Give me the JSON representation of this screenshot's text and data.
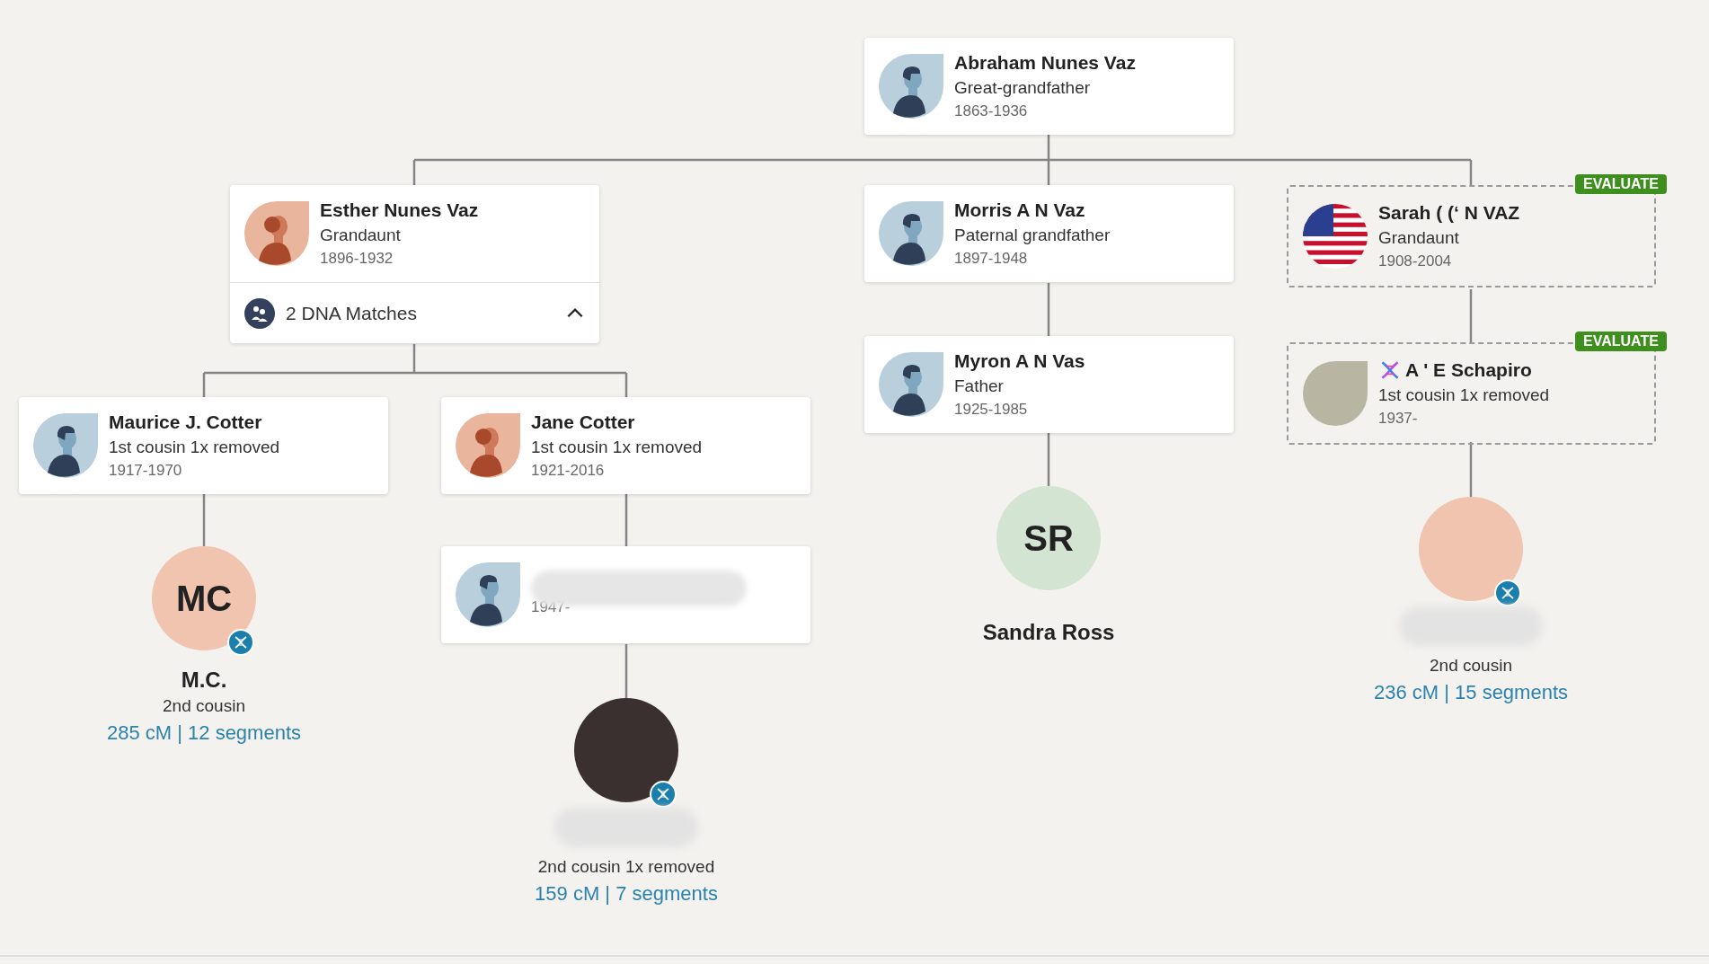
{
  "cards": [
    {
      "name": "Abraham Nunes Vaz",
      "relation": "Great-grandfather",
      "years": "1863-1936",
      "kind": "male",
      "dashed": false
    },
    {
      "name": "Esther Nunes Vaz",
      "relation": "Grandaunt",
      "years": "1896-1932",
      "kind": "female",
      "dashed": false,
      "dna_matches": {
        "label": "2 DNA Matches",
        "expanded": true
      }
    },
    {
      "name": "Morris A N Vaz",
      "relation": "Paternal grandfather",
      "years": "1897-1948",
      "kind": "male",
      "dashed": false
    },
    {
      "name": "Sarah ( (‘ N VAZ",
      "relation": "Grandaunt",
      "years": "1908-2004",
      "kind": "flag",
      "dashed": true,
      "badge": "EVALUATE"
    },
    {
      "name": "Myron A N Vas",
      "relation": "Father",
      "years": "1925-1985",
      "kind": "male",
      "dashed": false
    },
    {
      "name": "A ' E Schapiro",
      "relation": "1st cousin 1x removed",
      "years": "1937-",
      "kind": "photo",
      "dashed": true,
      "badge": "EVALUATE",
      "dna_icon": true
    },
    {
      "name": "Maurice J. Cotter",
      "relation": "1st cousin 1x removed",
      "years": "1917-1970",
      "kind": "male",
      "dashed": false
    },
    {
      "name": "Jane Cotter",
      "relation": "1st cousin 1x removed",
      "years": "1921-2016",
      "kind": "female",
      "dashed": false
    },
    {
      "years": "1947-",
      "kind": "male",
      "dashed": false,
      "redacted": true
    }
  ],
  "matches": [
    {
      "kind": "initials",
      "initials": "MC",
      "color": "#f0c4ae",
      "name": "M.C.",
      "relation": "2nd cousin",
      "shared": "285 cM | 12 segments",
      "dna_badge": true
    },
    {
      "kind": "photo",
      "color": "#3a3030",
      "name_redacted": true,
      "relation": "2nd cousin 1x removed",
      "shared": "159 cM | 7 segments",
      "dna_badge": true
    },
    {
      "kind": "initials",
      "initials": "SR",
      "color": "#d4e4d2",
      "name": "Sandra Ross",
      "dna_badge": false
    },
    {
      "kind": "photo",
      "color": "#f0c4ae",
      "name_redacted": true,
      "relation": "2nd cousin",
      "shared": "236 cM | 15 segments",
      "dna_badge": true
    }
  ]
}
